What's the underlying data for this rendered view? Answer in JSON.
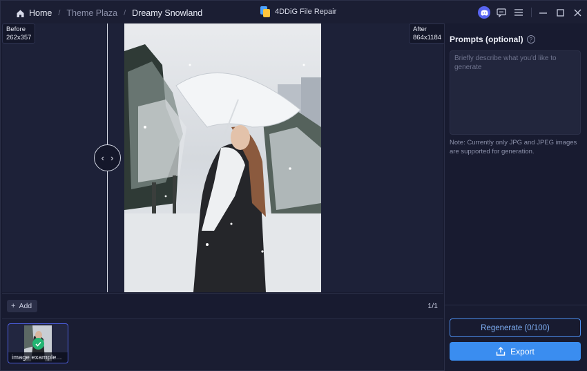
{
  "breadcrumb": {
    "home": "Home",
    "section": "Theme Plaza",
    "current": "Dreamy Snowland",
    "separator": "/"
  },
  "app": {
    "title": "4DDiG File Repair"
  },
  "window_controls": {
    "icons": [
      "discord-icon",
      "feedback-icon",
      "menu-icon",
      "minimize-icon",
      "maximize-icon",
      "close-icon"
    ]
  },
  "preview": {
    "before_label": "Before",
    "before_size": "262x357",
    "after_label": "After",
    "after_size": "864x1184",
    "compare_handle_left": "‹",
    "compare_handle_right": "›"
  },
  "toolbar": {
    "add_label": "Add",
    "page_count": "1/1"
  },
  "thumbnails": [
    {
      "label": "image example...",
      "selected": true
    }
  ],
  "panel": {
    "prompt_title": "Prompts (optional)",
    "prompt_placeholder": "Briefly describe what you'd like to generate",
    "prompt_value": "",
    "note": "Note: Currently only JPG and JPEG images are supported for generation.",
    "regenerate_label": "Regenerate (0/100)",
    "export_label": "Export"
  },
  "colors": {
    "accent": "#3a8df0",
    "background": "#181b30",
    "workspace": "#1d2138",
    "success": "#22b573"
  }
}
